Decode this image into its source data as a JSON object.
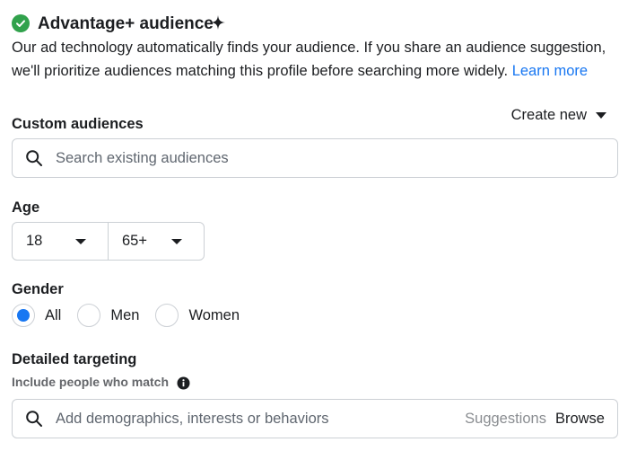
{
  "header": {
    "title": "Advantage+ audience",
    "description": "Our ad technology automatically finds your audience. If you share an audience suggestion, we'll prioritize audiences matching this profile before searching more widely.",
    "learn_more": "Learn more"
  },
  "custom_audiences": {
    "label": "Custom audiences",
    "create_new": "Create new",
    "search_placeholder": "Search existing audiences"
  },
  "age": {
    "label": "Age",
    "min": "18",
    "max": "65+"
  },
  "gender": {
    "label": "Gender",
    "options": [
      "All",
      "Men",
      "Women"
    ],
    "selected": "All"
  },
  "detailed_targeting": {
    "label": "Detailed targeting",
    "sublabel": "Include people who match",
    "search_placeholder": "Add demographics, interests or behaviors",
    "suggestions": "Suggestions",
    "browse": "Browse"
  },
  "colors": {
    "accent": "#1877f2",
    "success": "#31a24c",
    "border": "#ccd0d5"
  }
}
